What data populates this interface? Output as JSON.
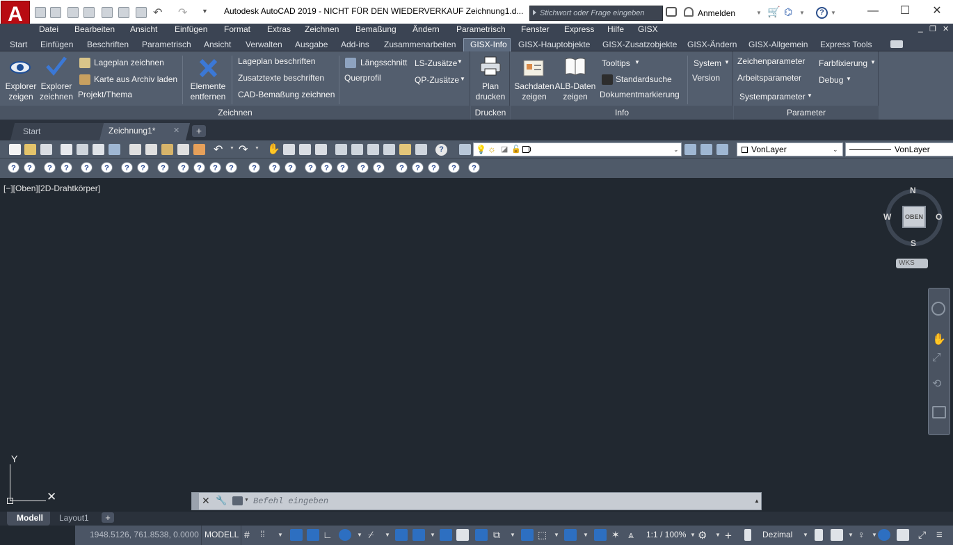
{
  "app": {
    "logo": "A",
    "title": "Autodesk AutoCAD 2019 - NICHT FÜR DEN WIEDERVERKAUF      Zeichnung1.d...",
    "search_placeholder": "Stichwort oder Frage eingeben",
    "signin": "Anmelden",
    "help_icon": "?"
  },
  "menubar": [
    "Datei",
    "Bearbeiten",
    "Ansicht",
    "Einfügen",
    "Format",
    "Extras",
    "Zeichnen",
    "Bemaßung",
    "Ändern",
    "Parametrisch",
    "Fenster",
    "Express",
    "Hilfe",
    "GISX"
  ],
  "ribbon_tabs": [
    "Start",
    "Einfügen",
    "Beschriften",
    "Parametrisch",
    "Ansicht",
    "Verwalten",
    "Ausgabe",
    "Add-ins",
    "Zusammenarbeiten",
    "GISX-Info",
    "GISX-Hauptobjekte",
    "GISX-Zusatzobjekte",
    "GISX-Ändern",
    "GISX-Allgemein",
    "Express Tools"
  ],
  "active_tab": "GISX-Info",
  "ribbon": {
    "zeichnen": {
      "title": "Zeichnen",
      "explorer_zeigen": "Explorer\nzeigen",
      "explorer_zeichnen": "Explorer\nzeichnen",
      "lageplan_zeichnen": "Lageplan zeichnen",
      "karte_laden": "Karte aus Archiv laden",
      "projekt_thema": "Projekt/Thema",
      "elemente_entfernen": "Elemente\nentfernen",
      "lageplan_beschriften": "Lageplan beschriften",
      "zusatztexte": "Zusatztexte beschriften",
      "cad_bemassung": "CAD-Bemaßung zeichnen",
      "laengsschnitt": "Längsschnitt",
      "querprofil": "Querprofil",
      "ls_zusaetze": "LS-Zusätze",
      "qp_zusaetze": "QP-Zusätze"
    },
    "drucken": {
      "title": "Drucken",
      "plan_drucken": "Plan\ndrucken"
    },
    "info": {
      "title": "Info",
      "sachdaten": "Sachdaten\nzeigen",
      "alb_daten": "ALB-Daten\nzeigen",
      "tooltips": "Tooltips",
      "standardsuche": "Standardsuche",
      "dokumentmarkierung": "Dokumentmarkierung",
      "system": "System",
      "version": "Version"
    },
    "parameter": {
      "title": "Parameter",
      "zeichenparameter": "Zeichenparameter",
      "arbeitsparameter": "Arbeitsparameter",
      "systemparameter": "Systemparameter",
      "farbfixierung": "Farbfixierung",
      "debug": "Debug"
    }
  },
  "doc_tabs": {
    "start": "Start",
    "drawing": "Zeichnung1*"
  },
  "toolbar": {
    "layer_value": "0",
    "color_value": "VonLayer",
    "linetype_value": "VonLayer"
  },
  "viewport": {
    "label": "[−][Oben][2D-Drahtkörper]",
    "compass": {
      "n": "N",
      "s": "S",
      "w": "W",
      "o": "O",
      "cube": "OBEN",
      "ucs": "WKS"
    },
    "axis_y": "Y"
  },
  "command": {
    "placeholder": "Befehl eingeben"
  },
  "layout_tabs": [
    "Modell",
    "Layout1"
  ],
  "status": {
    "coords": "1948.5126, 761.8538, 0.0000",
    "mode": "MODELL",
    "scale": "1:1 / 100%",
    "units": "Dezimal"
  },
  "colors": {
    "accent": "#b80b12",
    "ribbon": "#535e6e",
    "canvas": "#212830"
  }
}
